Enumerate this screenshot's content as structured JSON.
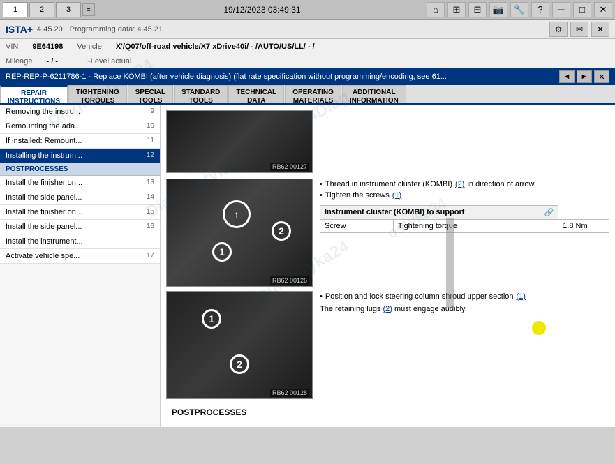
{
  "titleBar": {
    "tabs": [
      {
        "label": "1",
        "active": true
      },
      {
        "label": "2",
        "active": false
      },
      {
        "label": "3",
        "active": false
      }
    ],
    "datetime": "19/12/2023 03:49:31",
    "icons": [
      "⌂",
      "⊞",
      "⊟",
      "🔧",
      "?",
      "⊡",
      "⊠",
      "✕"
    ]
  },
  "appHeader": {
    "title": "ISTA+",
    "version": "4.45.20",
    "programmingData": "Programming data:  4.45.21",
    "icons": [
      "⚙",
      "✉",
      "✕"
    ]
  },
  "vehicleBar": {
    "vinLabel": "VIN",
    "vin": "9E64198",
    "vehicleLabel": "Vehicle",
    "vehicle": "X'/Q07/off-road vehicle/X7 xDrive40i/ - /AUTO/US/LL/ - /",
    "mileageLabel": "Mileage",
    "mileage": "- / -",
    "ilevelLabel": "I-Level actual"
  },
  "repairHeader": {
    "title": "REP-REP-P-6211786-1 - Replace KOMBI (after vehicle diagnosis) (flat rate specification without programming/encoding, see 61...",
    "navPrev": "◄",
    "navNext": "►",
    "close": "✕"
  },
  "tabs": [
    {
      "label": "REPAIR\nINSTRUCTIONS",
      "active": true
    },
    {
      "label": "TIGHTENING\nTORQUES",
      "active": false
    },
    {
      "label": "SPECIAL\nTOOLS",
      "active": false
    },
    {
      "label": "STANDARD\nTOOLS",
      "active": false
    },
    {
      "label": "TECHNICAL\nDATA",
      "active": false
    },
    {
      "label": "OPERATING\nMATERIALS",
      "active": false
    },
    {
      "label": "ADDITIONAL\nINFORMATION",
      "active": false
    }
  ],
  "leftPanel": {
    "items": [
      {
        "text": "Removing the instru...",
        "num": "9",
        "active": false
      },
      {
        "text": "Remounting the ada...",
        "num": "10",
        "active": false
      },
      {
        "text": "If installed: Remount...",
        "num": "11",
        "active": false
      },
      {
        "text": "Installing the instrum...",
        "num": "12",
        "active": true
      },
      {
        "sectionHeader": "POSTPROCESSES"
      },
      {
        "text": "Install the finisher on...",
        "num": "13",
        "active": false
      },
      {
        "text": "Install the side panel...",
        "num": "14",
        "active": false
      },
      {
        "text": "Install the finisher on...",
        "num": "15",
        "active": false
      },
      {
        "text": "Install the side panel...",
        "num": "16",
        "active": false
      },
      {
        "text": "Install the instrument...",
        "num": "",
        "active": false
      },
      {
        "text": "Activate vehicle spe...",
        "num": "17",
        "active": false
      }
    ]
  },
  "content": {
    "image1": {
      "label": "RB62 00127",
      "alt": "Instrument cluster installation step 1"
    },
    "image2": {
      "label": "RB62 00126",
      "alt": "Instrument cluster installation step 2"
    },
    "image3": {
      "label": "RB62 00128",
      "alt": "Steering column shroud step"
    },
    "bullets1": [
      {
        "text": "Thread in instrument cluster (KOMBI) (2) in direction of arrow."
      },
      {
        "text": "Tighten the screws (1)"
      }
    ],
    "tableTitle": "Instrument cluster (KOMBI) to support",
    "tableIcon": "🔗",
    "tableRows": [
      {
        "col1": "Screw",
        "col2": "Tightening torque",
        "col3": "1.8 Nm"
      }
    ],
    "bullets2": [
      {
        "text": "Position and lock steering column shroud upper section (1)"
      },
      {
        "text": "The retaining lugs (2) must engage audibly."
      }
    ],
    "postprocessesLabel": "POSTPROCESSES",
    "linkRefs": {
      "two": "2",
      "one": "1"
    }
  }
}
